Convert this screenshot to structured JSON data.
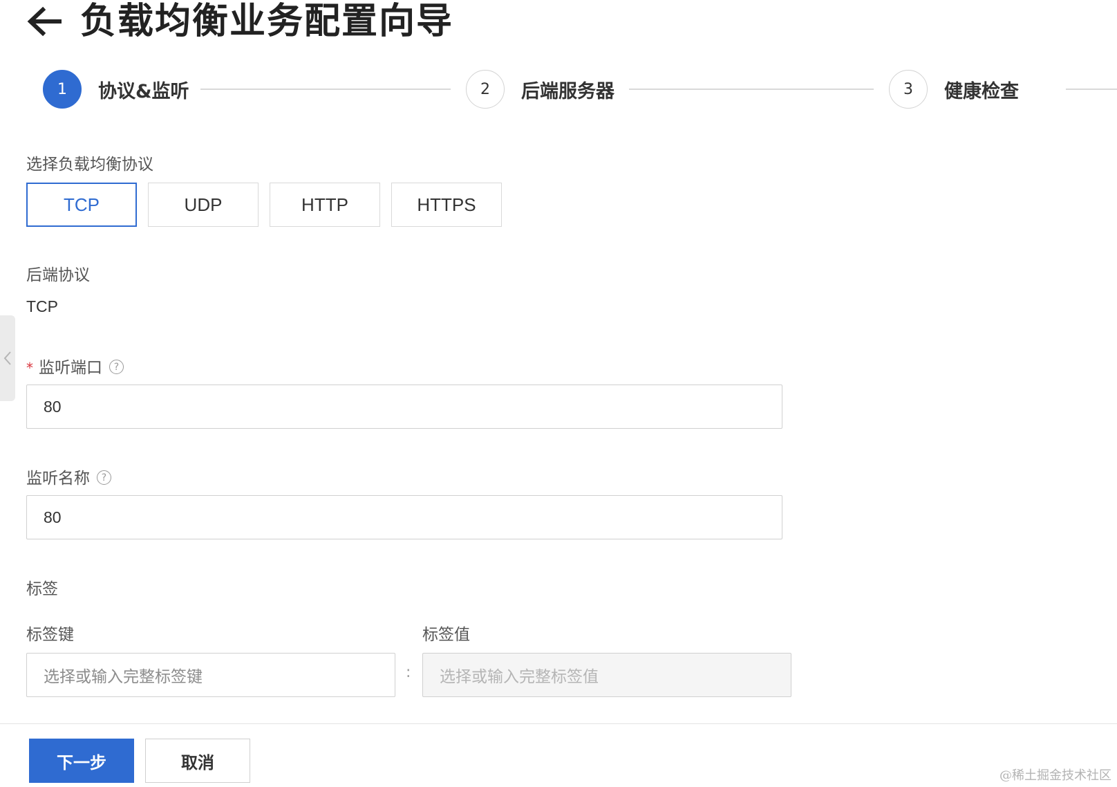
{
  "header": {
    "title": "负载均衡业务配置向导",
    "back_icon": "arrow-left-icon"
  },
  "steps": [
    {
      "number": "1",
      "label": "协议&监听",
      "status": "active"
    },
    {
      "number": "2",
      "label": "后端服务器",
      "status": "pending"
    },
    {
      "number": "3",
      "label": "健康检查",
      "status": "pending"
    }
  ],
  "protocol": {
    "label": "选择负载均衡协议",
    "options": [
      "TCP",
      "UDP",
      "HTTP",
      "HTTPS"
    ],
    "selected": "TCP"
  },
  "backend_protocol": {
    "label": "后端协议",
    "value": "TCP"
  },
  "listen_port": {
    "required_mark": "*",
    "label": "监听端口",
    "help": "?",
    "value": "80"
  },
  "listen_name": {
    "label": "监听名称",
    "help": "?",
    "value": "80"
  },
  "tags": {
    "section_label": "标签",
    "key_label": "标签键",
    "value_label": "标签值",
    "key_placeholder": "选择或输入完整标签键",
    "value_placeholder": "选择或输入完整标签值",
    "separator": ":"
  },
  "footer": {
    "next_label": "下一步",
    "cancel_label": "取消"
  },
  "watermark": "@稀土掘金技术社区",
  "colors": {
    "primary": "#2f6bd1",
    "required": "#d9363e"
  }
}
